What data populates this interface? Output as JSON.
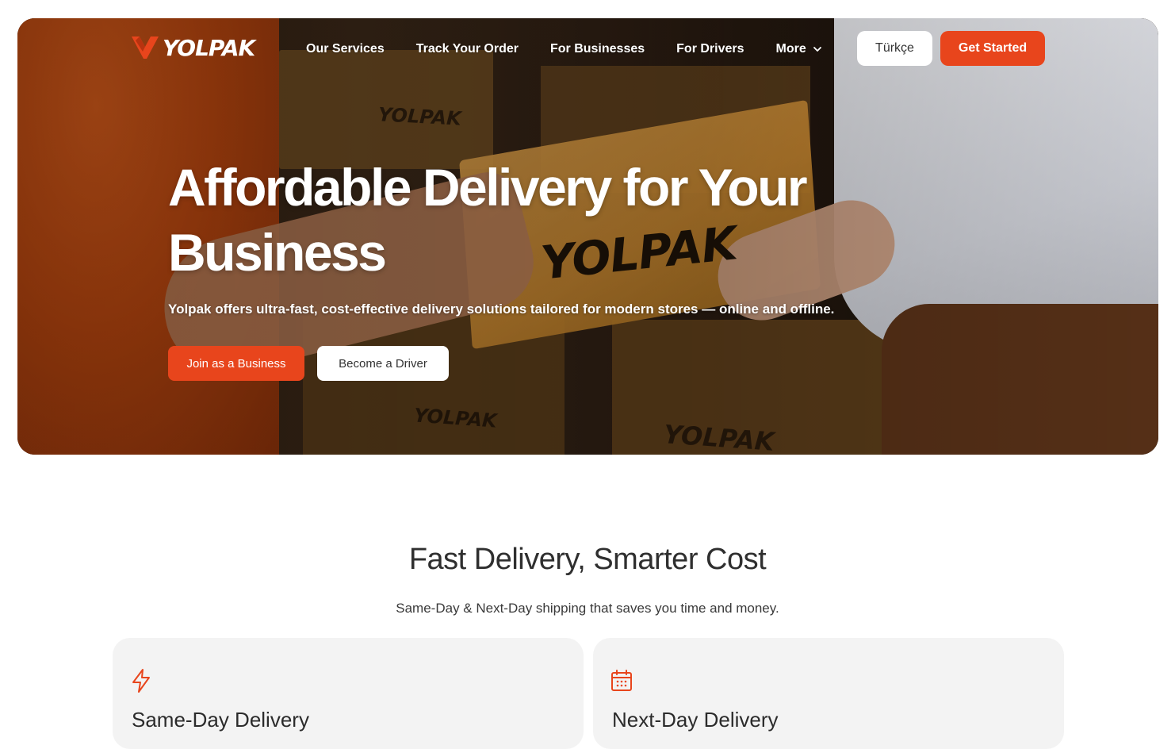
{
  "brand": {
    "name": "YOLPAK",
    "accent": "#e8451c"
  },
  "nav": {
    "items": [
      "Our Services",
      "Track Your Order",
      "For Businesses",
      "For Drivers",
      "More"
    ],
    "language_button": "Türkçe",
    "cta_button": "Get Started"
  },
  "hero": {
    "title_line1": "Affordable Delivery for Your",
    "title_line2": "Business",
    "subtitle": "Yolpak offers ultra-fast, cost-effective delivery solutions tailored for modern stores — online and offline.",
    "primary_button": "Join as a Business",
    "secondary_button": "Become a Driver"
  },
  "section": {
    "title": "Fast Delivery, Smarter Cost",
    "subtitle": "Same-Day & Next-Day shipping that saves you time and money."
  },
  "cards": [
    {
      "icon": "lightning-icon",
      "title": "Same-Day Delivery"
    },
    {
      "icon": "calendar-icon",
      "title": "Next-Day Delivery"
    }
  ]
}
